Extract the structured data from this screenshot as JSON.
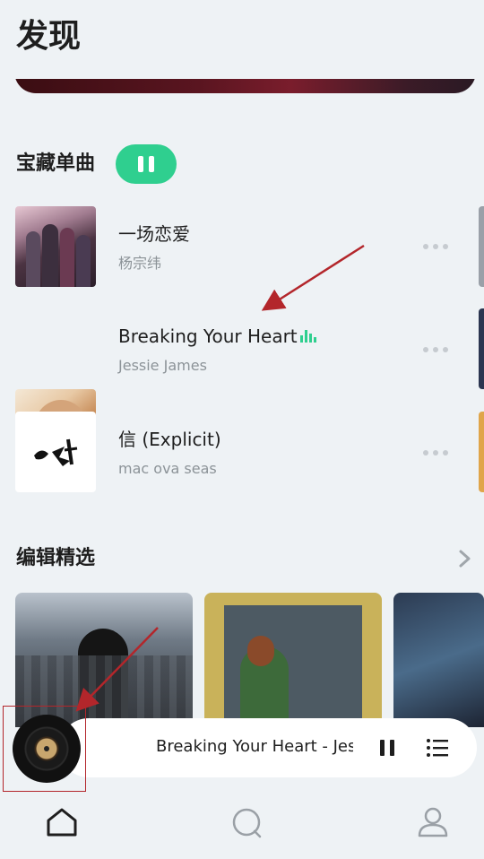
{
  "page": {
    "title": "发现"
  },
  "section_songs": {
    "title": "宝藏单曲",
    "songs": [
      {
        "title": "一场恋爱",
        "artist": "杨宗纬",
        "playing": false
      },
      {
        "title": "Breaking Your Heart",
        "artist": "Jessie James",
        "playing": true
      },
      {
        "title": "信 (Explicit)",
        "artist": "mac ova seas",
        "playing": false
      }
    ]
  },
  "section_editor": {
    "title": "编辑精选"
  },
  "mini_player": {
    "now_playing": "Breaking Your Heart - Jessie James"
  },
  "colors": {
    "accent": "#2fcf8f",
    "annotation": "#b3262b",
    "background": "#eef2f5"
  },
  "nav": {
    "items": [
      {
        "icon": "home-icon",
        "active": true
      },
      {
        "icon": "search-icon",
        "active": false
      },
      {
        "icon": "profile-icon",
        "active": false
      }
    ]
  }
}
